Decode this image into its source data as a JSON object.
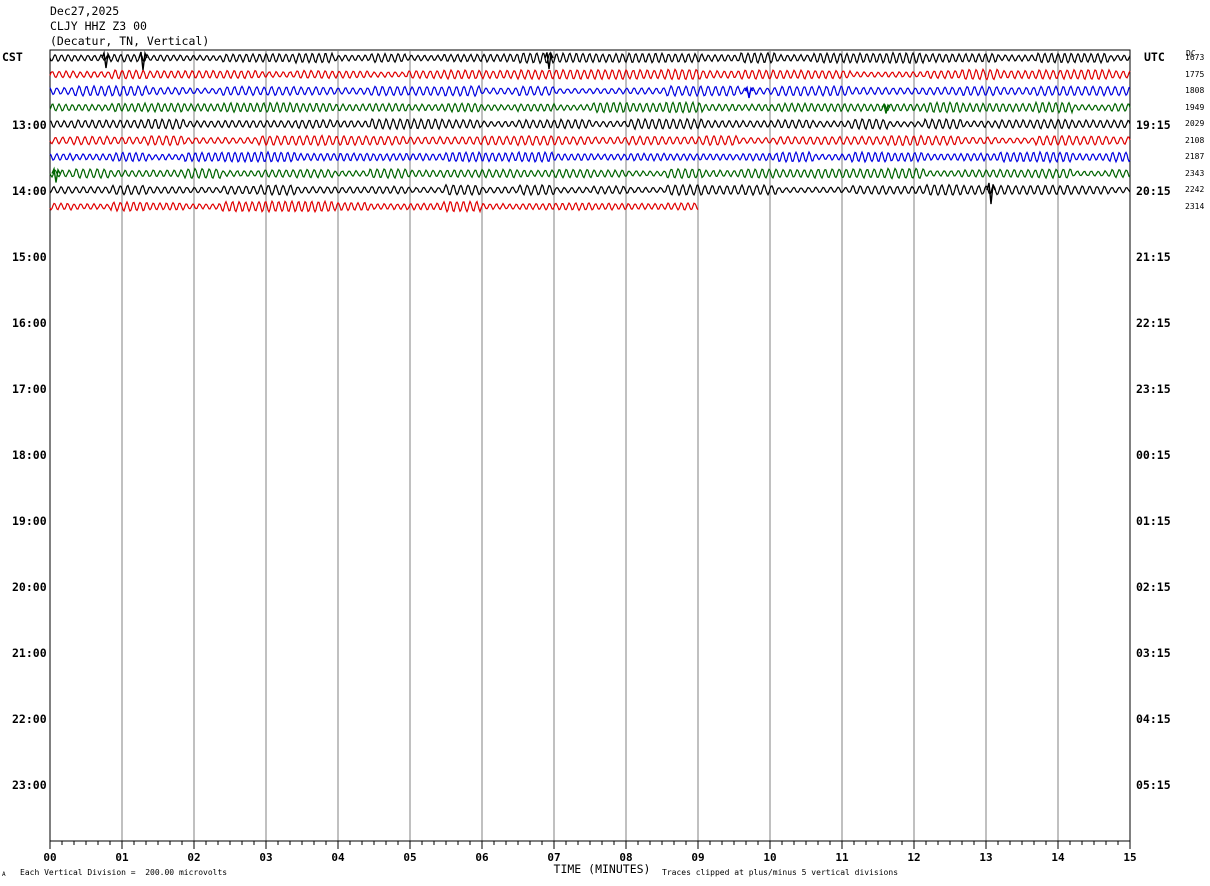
{
  "header": {
    "date": "Dec27,2025",
    "station": "CLJY HHZ Z3 00",
    "location": "(Decatur, TN, Vertical)"
  },
  "left_zone": "CST",
  "right_zone": "UTC",
  "right_corner": "DC",
  "footer": {
    "scale_note": "Each Vertical Division =  200.00 microvolts",
    "clip_note": "Traces clipped at plus/minus 5 vertical divisions",
    "corner_mark": "A"
  },
  "chart_data": {
    "type": "line",
    "title": "",
    "xlabel": "TIME (MINUTES)",
    "ylabel": "",
    "x_ticks": [
      "00",
      "01",
      "02",
      "03",
      "04",
      "05",
      "06",
      "07",
      "08",
      "09",
      "10",
      "11",
      "12",
      "13",
      "14",
      "15"
    ],
    "xlim": [
      0,
      15
    ],
    "grid": true,
    "left_hour_labels": [
      "13:00",
      "14:00",
      "15:00",
      "16:00",
      "17:00",
      "18:00",
      "19:00",
      "20:00",
      "21:00",
      "22:00",
      "23:00"
    ],
    "right_hour_labels": [
      "19:15",
      "20:15",
      "21:15",
      "22:15",
      "23:15",
      "00:15",
      "01:15",
      "02:15",
      "03:15",
      "04:15",
      "05:15"
    ],
    "trace_colors": [
      "#000000",
      "#e00000",
      "#0000e0",
      "#006400"
    ],
    "traces": [
      {
        "row": 0,
        "color": "#000000",
        "count": "1673",
        "end_minute": 15
      },
      {
        "row": 1,
        "color": "#e00000",
        "count": "1775",
        "end_minute": 15
      },
      {
        "row": 2,
        "color": "#0000e0",
        "count": "1808",
        "end_minute": 15
      },
      {
        "row": 3,
        "color": "#006400",
        "count": "1949",
        "end_minute": 15
      },
      {
        "row": 4,
        "color": "#000000",
        "count": "2029",
        "end_minute": 15
      },
      {
        "row": 5,
        "color": "#e00000",
        "count": "2108",
        "end_minute": 15
      },
      {
        "row": 6,
        "color": "#0000e0",
        "count": "2187",
        "end_minute": 15
      },
      {
        "row": 7,
        "color": "#006400",
        "count": "2343",
        "end_minute": 15
      },
      {
        "row": 8,
        "color": "#000000",
        "count": "2242",
        "end_minute": 15
      },
      {
        "row": 9,
        "color": "#e00000",
        "count": "2314",
        "end_minute": 9
      }
    ]
  }
}
